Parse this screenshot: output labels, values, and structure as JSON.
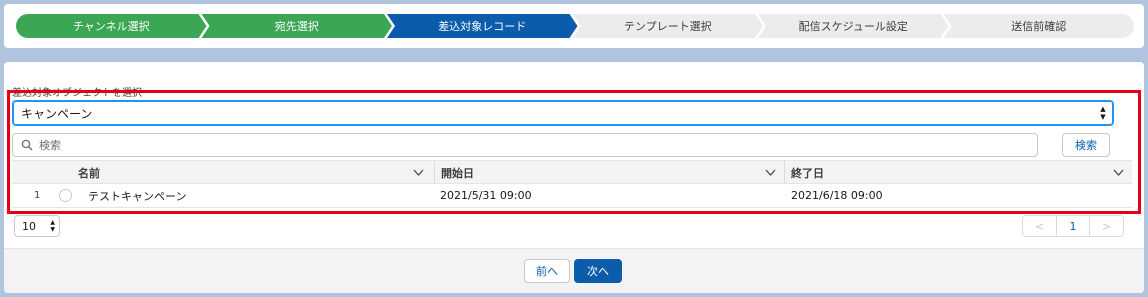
{
  "stepper": {
    "steps": [
      {
        "label": "チャンネル選択",
        "state": "done"
      },
      {
        "label": "宛先選択",
        "state": "done"
      },
      {
        "label": "差込対象レコード",
        "state": "current"
      },
      {
        "label": "テンプレート選択",
        "state": "todo"
      },
      {
        "label": "配信スケジュール設定",
        "state": "todo"
      },
      {
        "label": "送信前確認",
        "state": "todo"
      }
    ]
  },
  "object_select": {
    "label": "差込対象オブジェクトを選択",
    "value": "キャンペーン"
  },
  "search": {
    "placeholder": "検索",
    "button_label": "検索"
  },
  "table": {
    "columns": [
      "名前",
      "開始日",
      "終了日"
    ],
    "rows": [
      {
        "index": "1",
        "name": "テストキャンペーン",
        "start": "2021/5/31 09:00",
        "end": "2021/6/18 09:00"
      }
    ]
  },
  "pagination": {
    "page_size": "10",
    "prev": "<",
    "current_page": "1",
    "next": ">"
  },
  "footer": {
    "prev_label": "前へ",
    "next_label": "次へ"
  },
  "colors": {
    "done": "#3ba755",
    "current": "#0b5cab",
    "highlight": "#e30016"
  }
}
